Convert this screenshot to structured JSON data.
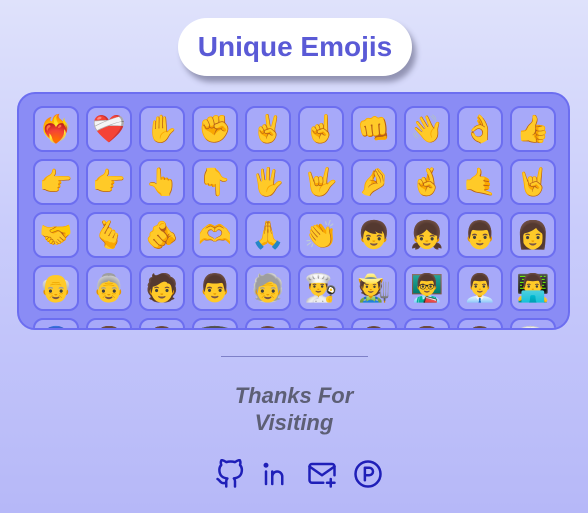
{
  "header": {
    "title": "Unique Emojis"
  },
  "emoji_rows": [
    [
      "❤️‍🔥",
      "❤️‍🩹",
      "✋",
      "✊",
      "✌️",
      "☝️",
      "👊",
      "👋",
      "👌",
      "👍"
    ],
    [
      "👉",
      "👉",
      "👆",
      "👇",
      "🖐️",
      "🤟",
      "🤌",
      "🤞",
      "🤙",
      "🤘"
    ],
    [
      "🤝",
      "🫰",
      "🫵",
      "🫶",
      "🙏",
      "👏",
      "👦",
      "👧",
      "👨",
      "👩"
    ],
    [
      "👴",
      "👵",
      "🧑",
      "👨",
      "🧓",
      "👨‍🍳",
      "🧑‍🌾",
      "👨‍🏫",
      "👨‍💼",
      "👨‍💻"
    ],
    [
      "👮",
      "👩",
      "👨",
      "👩‍🎓",
      "👨",
      "👨",
      "👨",
      "👩",
      "👨",
      "👨‍🍳"
    ]
  ],
  "footer": {
    "thanks_line1": "Thanks For",
    "thanks_line2": "Visiting",
    "socials": [
      "github-icon",
      "linkedin-icon",
      "mail-icon",
      "patreon-icon"
    ]
  },
  "colors": {
    "accent": "#5a5ad6",
    "panel": "#8a8cf5",
    "panel_border": "#6c6ef0",
    "icon": "#1f1fb8"
  }
}
